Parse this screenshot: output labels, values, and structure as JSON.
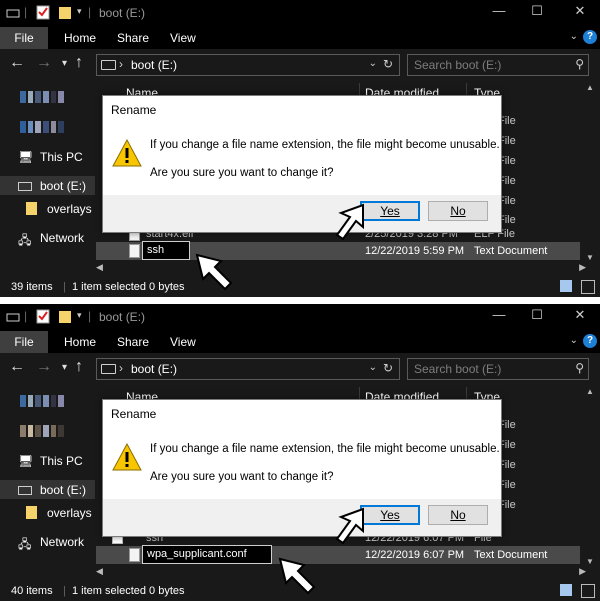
{
  "screens": [
    {
      "title": "boot (E:)",
      "ribbon": {
        "file": "File",
        "home": "Home",
        "share": "Share",
        "view": "View"
      },
      "address": "boot (E:)",
      "search_placeholder": "Search boot (E:)",
      "sidebar": {
        "this_pc": "This PC",
        "boot": "boot (E:)",
        "overlays": "overlays",
        "network": "Network"
      },
      "columns": {
        "name": "Name",
        "date": "Date modified",
        "type": "Type"
      },
      "type_partial": [
        "File",
        "File",
        "File",
        "File",
        "File",
        "File"
      ],
      "rows": [
        {
          "name": "start4x.elf",
          "date": "2/25/2019 3:28 PM",
          "type": "ELF File"
        },
        {
          "name": "ssh",
          "date": "12/22/2019 5:59 PM",
          "type": "Text Document"
        }
      ],
      "dialog": {
        "title": "Rename",
        "line1": "If you change a file name extension, the file might become unusable.",
        "line2": "Are you sure you want to change it?",
        "yes": "Yes",
        "no": "No"
      },
      "status": {
        "items": "39 items",
        "selected": "1 item selected  0 bytes"
      }
    },
    {
      "title": "boot (E:)",
      "ribbon": {
        "file": "File",
        "home": "Home",
        "share": "Share",
        "view": "View"
      },
      "address": "boot (E:)",
      "search_placeholder": "Search boot (E:)",
      "sidebar": {
        "this_pc": "This PC",
        "boot": "boot (E:)",
        "overlays": "overlays",
        "network": "Network"
      },
      "columns": {
        "name": "Name",
        "date": "Date modified",
        "type": "Type"
      },
      "type_partial": [
        "File",
        "File",
        "File",
        "File",
        "File"
      ],
      "rows": [
        {
          "name": "ssh",
          "date": "12/22/2019 6:07 PM",
          "type": "File"
        },
        {
          "name": "wpa_supplicant.conf",
          "date": "12/22/2019 6:07 PM",
          "type": "Text Document"
        }
      ],
      "dialog": {
        "title": "Rename",
        "line1": "If you change a file name extension, the file might become unusable.",
        "line2": "Are you sure you want to change it?",
        "yes": "Yes",
        "no": "No"
      },
      "status": {
        "items": "40 items",
        "selected": "1 item selected  0 bytes"
      }
    }
  ],
  "colors": {
    "accent": "#0078d7",
    "dark_bg": "#191919",
    "title_bg": "#000000",
    "warning": "#f7c600"
  },
  "icons": [
    "folder-icon",
    "checklist-icon",
    "drive-icon",
    "computer-icon",
    "network-icon",
    "warning-icon",
    "document-icon",
    "cursor-arrow-icon",
    "help-icon",
    "search-icon"
  ]
}
